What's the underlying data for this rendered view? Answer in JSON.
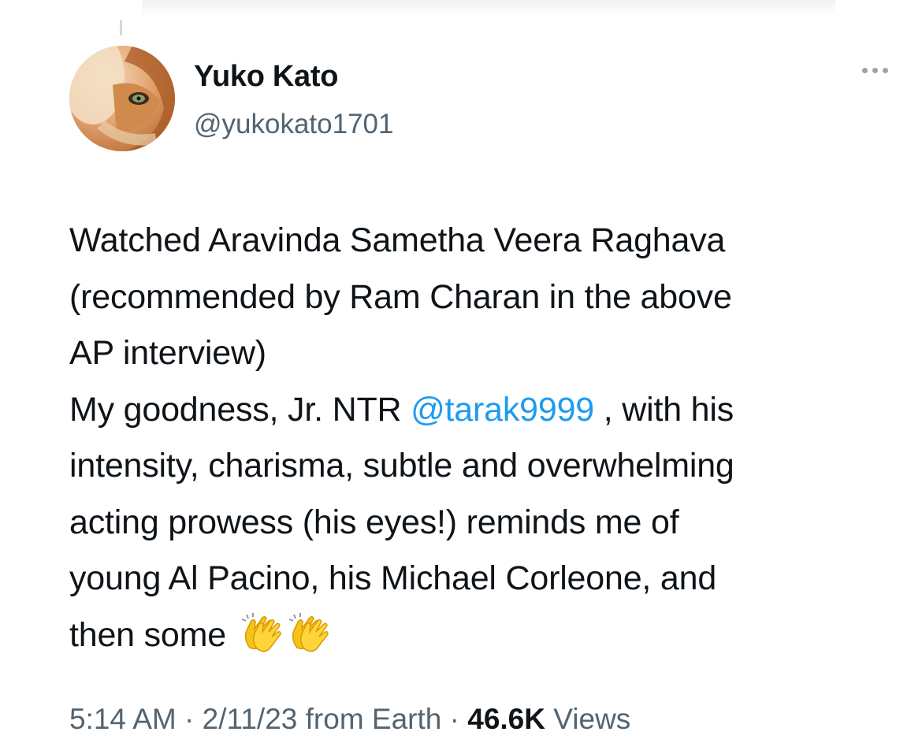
{
  "tweet": {
    "author": {
      "display_name": "Yuko Kato",
      "handle": "@yukokato1701",
      "avatar_icon": "cat-photo-avatar"
    },
    "more_icon": "more-options-icon",
    "text": {
      "line1": "Watched Aravinda Sametha Veera Raghava",
      "line2": "(recommended by Ram Charan in the above",
      "line3": "AP interview)",
      "line4_before": "My goodness, Jr. NTR ",
      "line4_mention": "@tarak9999",
      "line4_after": " , with his",
      "line5": "intensity, charisma, subtle and overwhelming",
      "line6": "acting prowess (his eyes!) reminds me of",
      "line7": "young Al Pacino, his Michael Corleone, and",
      "line8": "then some",
      "emoji": "clapping-hands-emoji"
    },
    "meta": {
      "time": "5:14 AM",
      "separator": " · ",
      "date": "2/11/23",
      "source": " from Earth",
      "views_count": "46.6K",
      "views_label": " Views"
    },
    "colors": {
      "mention": "#1d9bf0",
      "secondary_text": "#536471",
      "primary_text": "#0f1419"
    }
  }
}
